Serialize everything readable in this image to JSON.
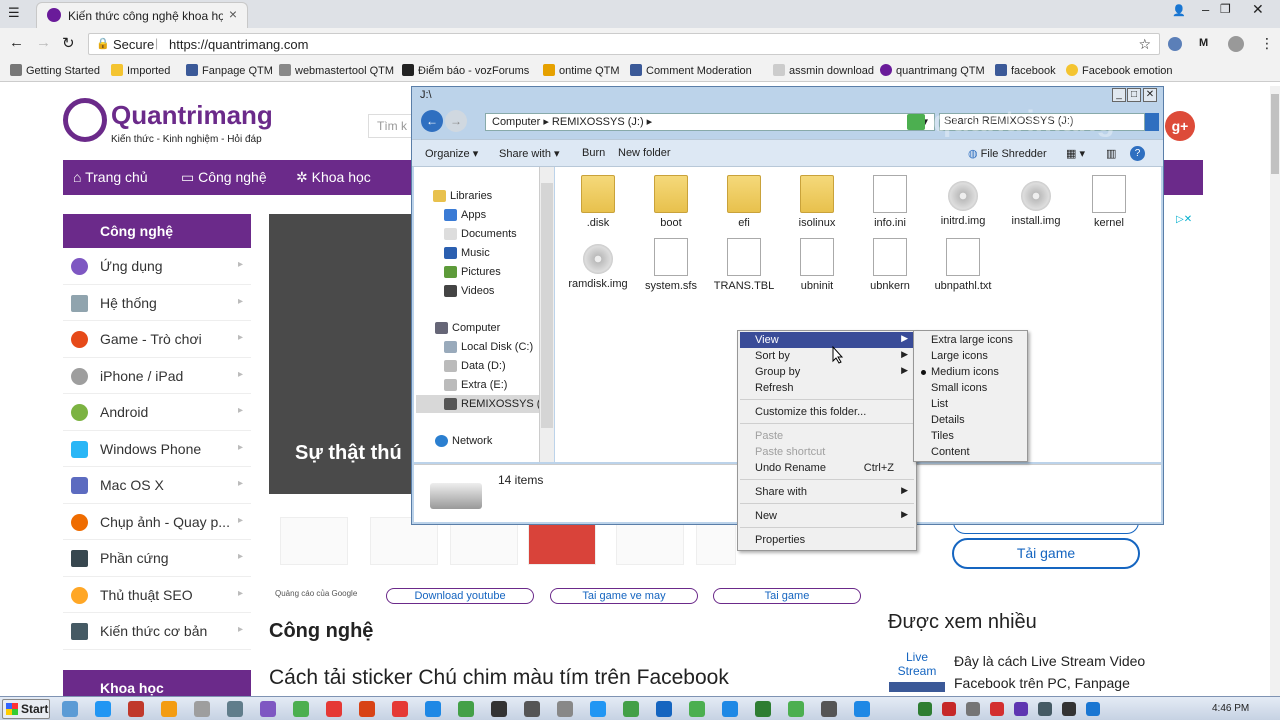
{
  "browser": {
    "tab_title": "Kiến thức công nghệ khoa học",
    "secure_label": "Secure",
    "url": "https://quantrimang.com",
    "bookmarks": [
      "Getting Started",
      "Imported",
      "Fanpage QTM",
      "webmastertool QTM",
      "Điểm báo - vozForums",
      "ontime QTM",
      "Comment Moderation",
      "assmin download",
      "quantrimang QTM",
      "facebook",
      "Facebook emotion"
    ],
    "colors": {
      "tabbar": "#dee1e6",
      "toolbar": "#f2f2f2"
    }
  },
  "site": {
    "logo_text": "Quantrimang",
    "tagline": "Kiến thức - Kinh nghiệm - Hỏi đáp",
    "search_placeholder": "Tìm k",
    "nav": [
      "Trang chủ",
      "Công nghệ",
      "Khoa học"
    ],
    "sidebar_title": "Công nghệ",
    "sidebar_items": [
      "Ứng dụng",
      "Hệ thống",
      "Game - Trò chơi",
      "iPhone / iPad",
      "Android",
      "Windows Phone",
      "Mac OS X",
      "Chụp ảnh - Quay p...",
      "Phần cứng",
      "Thủ thuật SEO",
      "Kiến thức cơ bản"
    ],
    "sidebar_bottom": "Khoa học",
    "hero_caption": "Sự thật thú",
    "ad_label": "Quảng cáo của Google",
    "pills": [
      "Download youtube",
      "Tai game ve may",
      "Tai game"
    ],
    "section_title": "Công nghệ",
    "article_title": "Cách tải sticker Chú chim màu tím trên Facebook",
    "tai_game": "Tải game",
    "most_viewed": "Được xem nhiều",
    "live_stream_logo": "Live Stream",
    "most_viewed_item": "Đây là cách Live Stream Video Facebook trên PC, Fanpage",
    "gplus": "g+",
    "accent": "#6b2a8a"
  },
  "explorer": {
    "title": "J:\\",
    "breadcrumb": "Computer ▸ REMIXOSSYS (J:) ▸",
    "search_placeholder": "Search REMIXOSSYS (J:)",
    "commands": [
      "Organize ▾",
      "Share with ▾",
      "Burn",
      "New folder"
    ],
    "file_shredder": "File Shredder",
    "nav_items": {
      "libraries": "Libraries",
      "apps": "Apps",
      "documents": "Documents",
      "music": "Music",
      "pictures": "Pictures",
      "videos": "Videos",
      "computer": "Computer",
      "c": "Local Disk (C:)",
      "d": "Data (D:)",
      "e": "Extra (E:)",
      "j": "REMIXOSSYS (J:)",
      "network": "Network"
    },
    "files": [
      {
        "name": ".disk",
        "kind": "folder"
      },
      {
        "name": "boot",
        "kind": "folder"
      },
      {
        "name": "efi",
        "kind": "folder"
      },
      {
        "name": "isolinux",
        "kind": "folder"
      },
      {
        "name": "info.ini",
        "kind": "doc"
      },
      {
        "name": "initrd.img",
        "kind": "disc"
      },
      {
        "name": "install.img",
        "kind": "disc"
      },
      {
        "name": "kernel",
        "kind": "doc"
      },
      {
        "name": "ramdisk.img",
        "kind": "disc"
      },
      {
        "name": "system.sfs",
        "kind": "doc"
      },
      {
        "name": "TRANS.TBL",
        "kind": "doc"
      },
      {
        "name": "ubninit",
        "kind": "doc"
      },
      {
        "name": "ubnkern",
        "kind": "doc"
      },
      {
        "name": "ubnpathl.txt",
        "kind": "doc"
      }
    ],
    "status": "14 items",
    "watermark": "quantrimang"
  },
  "context_menu": {
    "view": "View",
    "sort_by": "Sort by",
    "group_by": "Group by",
    "refresh": "Refresh",
    "customize": "Customize this folder...",
    "paste": "Paste",
    "paste_shortcut": "Paste shortcut",
    "undo_rename": "Undo Rename",
    "undo_shortcut": "Ctrl+Z",
    "share_with": "Share with",
    "new": "New",
    "properties": "Properties"
  },
  "view_submenu": [
    "Extra large icons",
    "Large icons",
    "Medium icons",
    "Small icons",
    "List",
    "Details",
    "Tiles",
    "Content"
  ],
  "view_selected": "Medium icons",
  "taskbar": {
    "start": "Start",
    "time": "4:46 PM"
  }
}
